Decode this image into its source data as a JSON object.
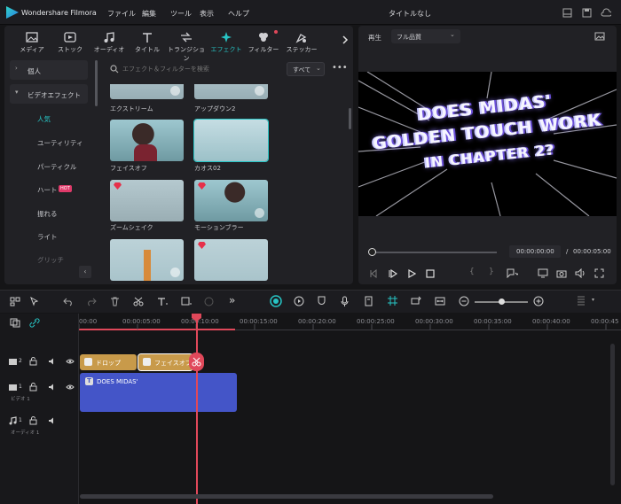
{
  "app": {
    "title": "Wondershare Filmora",
    "doc_title": "タイトルなし",
    "menu": [
      "ファイル",
      "編集",
      "ツール",
      "表示",
      "ヘルプ"
    ]
  },
  "tabs": [
    {
      "label": "メディア",
      "icon": "media-icon"
    },
    {
      "label": "ストック",
      "icon": "stock-icon"
    },
    {
      "label": "オーディオ",
      "icon": "audio-icon"
    },
    {
      "label": "タイトル",
      "icon": "title-icon"
    },
    {
      "label": "トランジション",
      "icon": "transition-icon"
    },
    {
      "label": "エフェクト",
      "icon": "effects-icon",
      "active": true
    },
    {
      "label": "フィルター",
      "icon": "filter-icon"
    },
    {
      "label": "ステッカー",
      "icon": "sticker-icon"
    }
  ],
  "sidebar": {
    "items": [
      {
        "label": "個人",
        "expanded": false
      },
      {
        "label": "ビデオエフェクト",
        "expanded": true
      },
      {
        "label": "人気",
        "active": true
      },
      {
        "label": "ユーティリティ"
      },
      {
        "label": "パーティクル"
      },
      {
        "label": "ハート",
        "badge": "HOT"
      },
      {
        "label": "振れる"
      },
      {
        "label": "ライト"
      },
      {
        "label": "グリッチ"
      }
    ]
  },
  "search": {
    "placeholder": "エフェクト＆フィルターを検索",
    "filter": "すべて"
  },
  "effects": [
    {
      "name": "エクストリーム"
    },
    {
      "name": "アップダウン2"
    },
    {
      "name": "フェイスオフ"
    },
    {
      "name": "カオス02"
    },
    {
      "name": "ズームシェイク"
    },
    {
      "name": "モーションブラー"
    }
  ],
  "preview": {
    "label": "再生",
    "quality": "フル品質",
    "text_lines": [
      "DOES MIDAS'",
      "GOLDEN TOUCH WORK",
      "IN CHAPTER 2?"
    ],
    "current_time": "00:00:00:00",
    "separator": "/",
    "total_time": "00:00:05:00"
  },
  "timeline": {
    "ruler": [
      "00:00",
      "00:00:05:00",
      "00:00:10:00",
      "00:00:15:00",
      "00:00:20:00",
      "00:00:25:00",
      "00:00:30:00",
      "00:00:35:00",
      "00:00:40:00",
      "00:00:45"
    ],
    "tracks": [
      {
        "num": "2",
        "label": ""
      },
      {
        "num": "1",
        "label": "ビデオ 1"
      },
      {
        "num": "1",
        "label": "オーディオ 1"
      }
    ],
    "clips": [
      {
        "label": "ドロップ",
        "type": "effect"
      },
      {
        "label": "フェイスオフ",
        "type": "effect"
      },
      {
        "label": "DOES MIDAS'",
        "type": "title"
      }
    ]
  },
  "colors": {
    "accent": "#27c4c4",
    "playhead": "#e0485a",
    "clip_effect": "#c89a4a",
    "clip_title": "#4455c8"
  }
}
